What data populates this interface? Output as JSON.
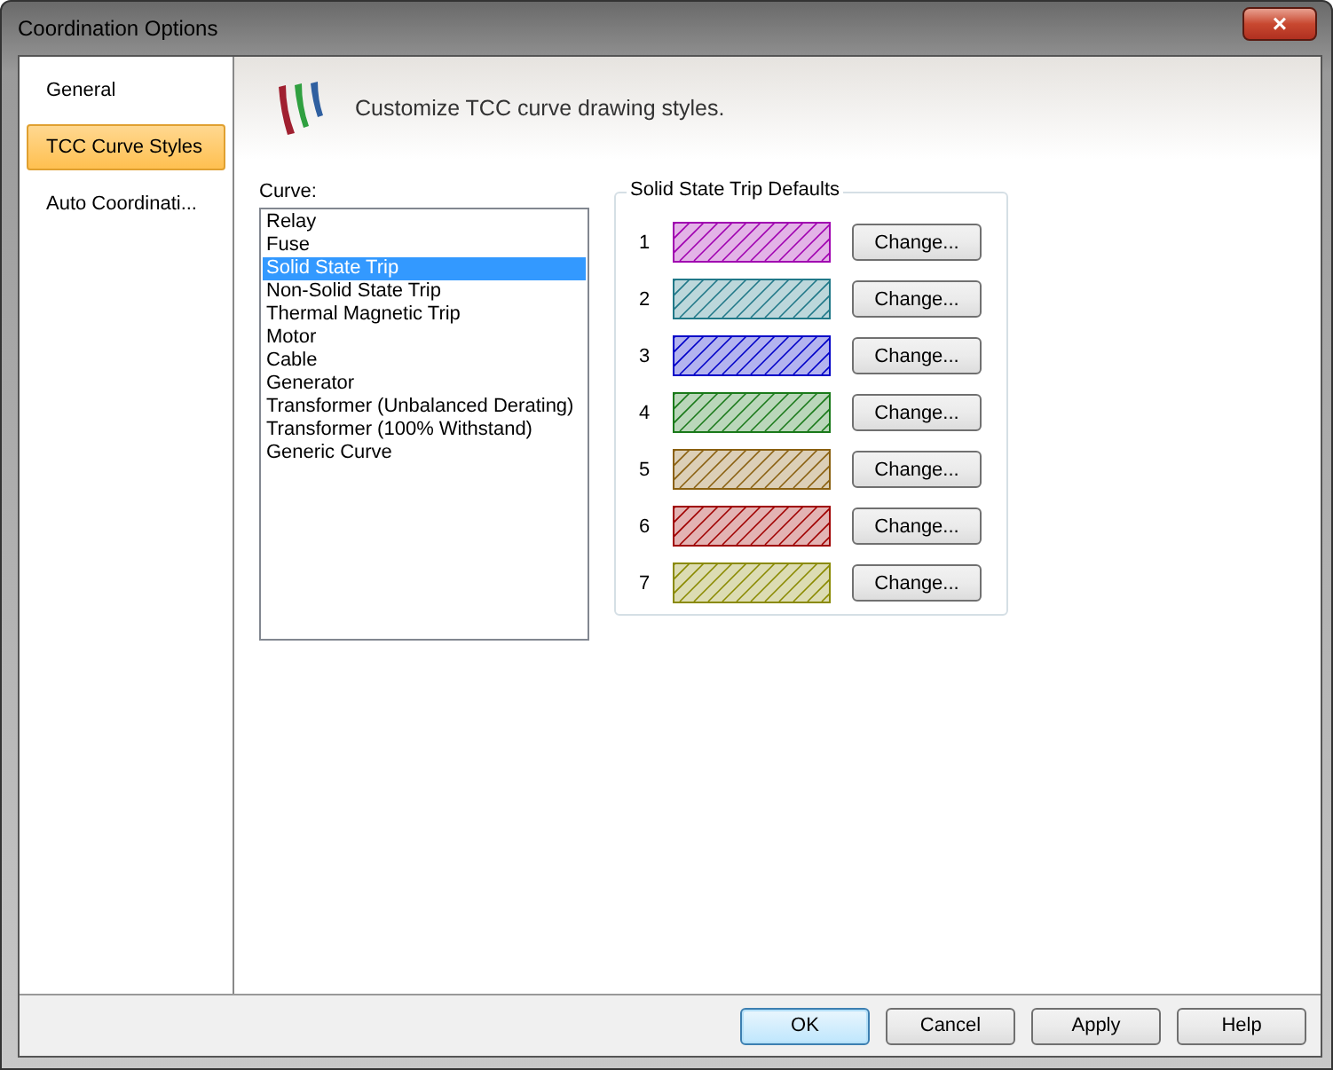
{
  "window": {
    "title": "Coordination Options",
    "close": "×"
  },
  "sidebar": {
    "items": [
      {
        "label": "General",
        "selected": false
      },
      {
        "label": "TCC Curve Styles",
        "selected": true
      },
      {
        "label": "Auto Coordinati...",
        "selected": false
      }
    ]
  },
  "header": {
    "text": "Customize TCC curve drawing styles."
  },
  "curve_list": {
    "label": "Curve:",
    "items": [
      {
        "label": "Relay",
        "selected": false
      },
      {
        "label": "Fuse",
        "selected": false
      },
      {
        "label": "Solid State Trip",
        "selected": true
      },
      {
        "label": "Non-Solid State Trip",
        "selected": false
      },
      {
        "label": "Thermal Magnetic Trip",
        "selected": false
      },
      {
        "label": "Motor",
        "selected": false
      },
      {
        "label": "Cable",
        "selected": false
      },
      {
        "label": "Generator",
        "selected": false
      },
      {
        "label": "Transformer (Unbalanced Derating)",
        "selected": false
      },
      {
        "label": "Transformer (100% Withstand)",
        "selected": false
      },
      {
        "label": "Generic Curve",
        "selected": false
      }
    ]
  },
  "defaults": {
    "title": "Solid State Trip Defaults",
    "styles": [
      {
        "number": "1",
        "color": "#a000b0",
        "button": "Change..."
      },
      {
        "number": "2",
        "color": "#207888",
        "button": "Change..."
      },
      {
        "number": "3",
        "color": "#0000c8",
        "button": "Change..."
      },
      {
        "number": "4",
        "color": "#1a7a1a",
        "button": "Change..."
      },
      {
        "number": "5",
        "color": "#8a6010",
        "button": "Change..."
      },
      {
        "number": "6",
        "color": "#a00000",
        "button": "Change..."
      },
      {
        "number": "7",
        "color": "#8a8a00",
        "button": "Change..."
      }
    ]
  },
  "buttons": [
    {
      "label": "OK",
      "default": true
    },
    {
      "label": "Cancel",
      "default": false
    },
    {
      "label": "Apply",
      "default": false
    },
    {
      "label": "Help",
      "default": false
    }
  ]
}
